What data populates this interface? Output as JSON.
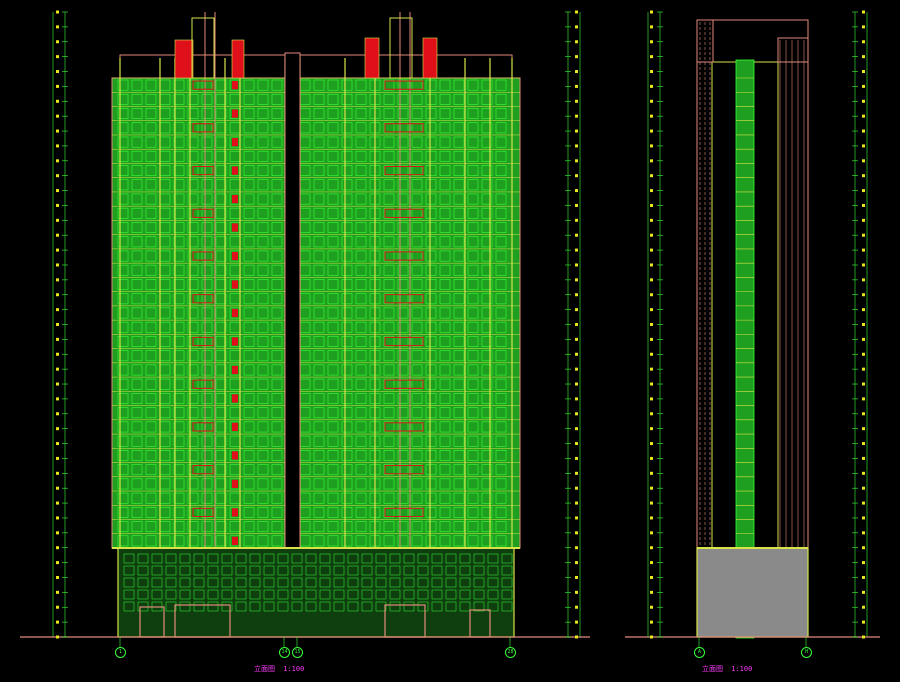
{
  "drawing": {
    "colors": {
      "background": "#000000",
      "glass": "#1f9f1f",
      "frame": "#d8e34a",
      "mullion": "#39ff39",
      "balcony_red": "#e0101a",
      "outline": "#e28a7a",
      "hatch": "#8a8a8a",
      "dimension": "#39ff39",
      "label": "#ff3cff"
    },
    "elevation_front": {
      "caption": "立面图",
      "scale": "1:100",
      "axis_left": "1",
      "axis_mid_a": "14",
      "axis_mid_b": "15",
      "axis_right": "28"
    },
    "elevation_side": {
      "caption": "立面图",
      "scale": "1:100",
      "axis_left": "A",
      "axis_right": "H"
    },
    "floors": 33
  }
}
